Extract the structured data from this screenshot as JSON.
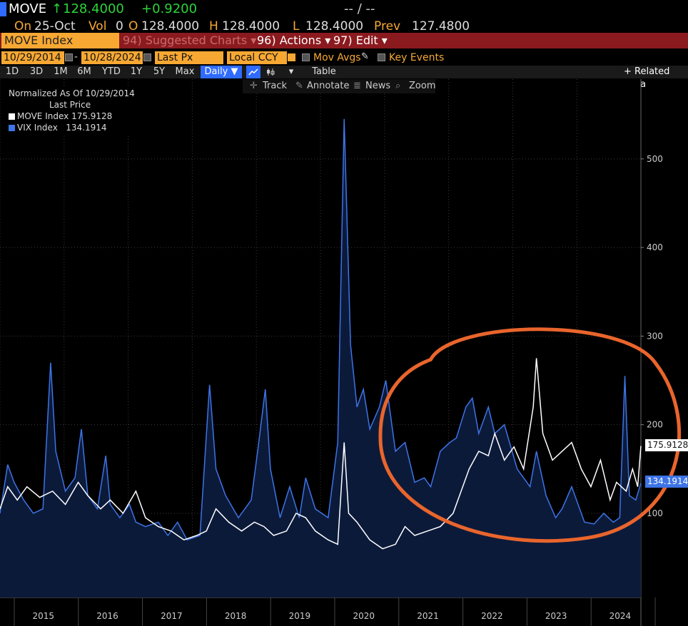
{
  "header": {
    "ticker": "MOVE",
    "arrow": "↑",
    "last": "128.4000",
    "change": "+0.9200",
    "bidask": "-- / --",
    "on_label": "On",
    "on_date": "25-Oct",
    "vol_label": "Vol",
    "vol_value": "0",
    "open_label": "O",
    "open_value": "128.4000",
    "high_label": "H",
    "high_value": "128.4000",
    "low_label": "L",
    "low_value": "128.4000",
    "prev_label": "Prev",
    "prev_value": "127.4800"
  },
  "menubar": {
    "title": "MOVE Index",
    "suggested_num": "94)",
    "suggested_label": "Suggested Charts",
    "actions_num": "96)",
    "actions_label": "Actions",
    "edit_num": "97)",
    "edit_label": "Edit",
    "dropdown_glyph": "▾"
  },
  "controls": {
    "start_date": "10/29/2014",
    "end_date": "10/28/2024",
    "dash": "-",
    "field": "Last Px",
    "currency": "Local CCY",
    "mov_avgs": "Mov Avgs",
    "key_events": "Key Events"
  },
  "periods": [
    "1D",
    "3D",
    "1M",
    "6M",
    "YTD",
    "1Y",
    "5Y",
    "Max"
  ],
  "frequency": "Daily ▼",
  "table_label": "Table",
  "related_label": "+ Related Data",
  "tools": {
    "track": "Track",
    "annotate": "Annotate",
    "news": "News",
    "zoom": "Zoom"
  },
  "legend": {
    "normalized": "Normalized As Of 10/29/2014",
    "last_price": "Last Price"
  },
  "colors": {
    "move": "#ffffff",
    "vix": "#3d74e6",
    "vix_fill": "#0c1a3a",
    "orange": "#f7a833",
    "annotation": "#e9652c",
    "menubar": "#8b1a1f"
  },
  "chart_data": {
    "type": "line",
    "x_ticks": [
      "2015",
      "2016",
      "2017",
      "2018",
      "2019",
      "2020",
      "2021",
      "2022",
      "2023",
      "2024"
    ],
    "y_ticks": [
      100,
      200,
      300,
      400,
      500
    ],
    "ylim": [
      5,
      590
    ],
    "xlim": [
      2014.83,
      2024.83
    ],
    "grid": true,
    "annotation": "orange ellipse around 2022-2024",
    "series": [
      {
        "name": "VIX Index",
        "color": "#3d74e6",
        "last": "134.1914",
        "points": [
          [
            2014.83,
            100
          ],
          [
            2014.95,
            155
          ],
          [
            2015.05,
            135
          ],
          [
            2015.2,
            115
          ],
          [
            2015.35,
            100
          ],
          [
            2015.5,
            105
          ],
          [
            2015.62,
            270
          ],
          [
            2015.7,
            170
          ],
          [
            2015.85,
            125
          ],
          [
            2016.0,
            140
          ],
          [
            2016.1,
            195
          ],
          [
            2016.2,
            120
          ],
          [
            2016.35,
            105
          ],
          [
            2016.48,
            165
          ],
          [
            2016.55,
            110
          ],
          [
            2016.7,
            95
          ],
          [
            2016.85,
            110
          ],
          [
            2016.95,
            90
          ],
          [
            2017.1,
            85
          ],
          [
            2017.3,
            90
          ],
          [
            2017.45,
            75
          ],
          [
            2017.6,
            90
          ],
          [
            2017.75,
            70
          ],
          [
            2017.95,
            75
          ],
          [
            2018.1,
            245
          ],
          [
            2018.2,
            150
          ],
          [
            2018.35,
            120
          ],
          [
            2018.55,
            95
          ],
          [
            2018.75,
            115
          ],
          [
            2018.85,
            170
          ],
          [
            2018.97,
            240
          ],
          [
            2019.05,
            150
          ],
          [
            2019.2,
            95
          ],
          [
            2019.35,
            130
          ],
          [
            2019.5,
            95
          ],
          [
            2019.6,
            140
          ],
          [
            2019.75,
            105
          ],
          [
            2019.95,
            95
          ],
          [
            2020.1,
            180
          ],
          [
            2020.2,
            545
          ],
          [
            2020.3,
            290
          ],
          [
            2020.4,
            220
          ],
          [
            2020.5,
            240
          ],
          [
            2020.6,
            195
          ],
          [
            2020.75,
            220
          ],
          [
            2020.85,
            250
          ],
          [
            2021.0,
            170
          ],
          [
            2021.15,
            180
          ],
          [
            2021.3,
            135
          ],
          [
            2021.45,
            140
          ],
          [
            2021.55,
            130
          ],
          [
            2021.7,
            170
          ],
          [
            2021.85,
            180
          ],
          [
            2021.95,
            185
          ],
          [
            2022.1,
            220
          ],
          [
            2022.2,
            230
          ],
          [
            2022.3,
            190
          ],
          [
            2022.45,
            220
          ],
          [
            2022.55,
            190
          ],
          [
            2022.7,
            200
          ],
          [
            2022.8,
            175
          ],
          [
            2022.9,
            150
          ],
          [
            2023.0,
            140
          ],
          [
            2023.1,
            130
          ],
          [
            2023.2,
            170
          ],
          [
            2023.35,
            120
          ],
          [
            2023.5,
            95
          ],
          [
            2023.6,
            105
          ],
          [
            2023.75,
            130
          ],
          [
            2023.85,
            110
          ],
          [
            2023.95,
            90
          ],
          [
            2024.1,
            88
          ],
          [
            2024.25,
            100
          ],
          [
            2024.4,
            90
          ],
          [
            2024.5,
            95
          ],
          [
            2024.58,
            255
          ],
          [
            2024.65,
            120
          ],
          [
            2024.75,
            115
          ],
          [
            2024.83,
            134
          ]
        ]
      },
      {
        "name": "MOVE Index",
        "color": "#ffffff",
        "last": "175.9128",
        "points": [
          [
            2014.83,
            105
          ],
          [
            2014.95,
            130
          ],
          [
            2015.1,
            115
          ],
          [
            2015.25,
            130
          ],
          [
            2015.45,
            118
          ],
          [
            2015.65,
            125
          ],
          [
            2015.85,
            110
          ],
          [
            2016.05,
            135
          ],
          [
            2016.2,
            120
          ],
          [
            2016.4,
            105
          ],
          [
            2016.55,
            115
          ],
          [
            2016.75,
            100
          ],
          [
            2016.95,
            125
          ],
          [
            2017.1,
            95
          ],
          [
            2017.3,
            85
          ],
          [
            2017.5,
            80
          ],
          [
            2017.7,
            70
          ],
          [
            2017.9,
            75
          ],
          [
            2018.05,
            80
          ],
          [
            2018.2,
            105
          ],
          [
            2018.4,
            90
          ],
          [
            2018.6,
            80
          ],
          [
            2018.8,
            90
          ],
          [
            2018.95,
            85
          ],
          [
            2019.1,
            75
          ],
          [
            2019.3,
            80
          ],
          [
            2019.45,
            100
          ],
          [
            2019.6,
            95
          ],
          [
            2019.75,
            80
          ],
          [
            2019.95,
            70
          ],
          [
            2020.1,
            65
          ],
          [
            2020.2,
            180
          ],
          [
            2020.27,
            100
          ],
          [
            2020.4,
            90
          ],
          [
            2020.6,
            70
          ],
          [
            2020.8,
            60
          ],
          [
            2021.0,
            65
          ],
          [
            2021.15,
            85
          ],
          [
            2021.3,
            75
          ],
          [
            2021.5,
            80
          ],
          [
            2021.7,
            85
          ],
          [
            2021.9,
            100
          ],
          [
            2022.0,
            120
          ],
          [
            2022.15,
            150
          ],
          [
            2022.3,
            170
          ],
          [
            2022.45,
            165
          ],
          [
            2022.55,
            190
          ],
          [
            2022.7,
            160
          ],
          [
            2022.85,
            175
          ],
          [
            2023.0,
            150
          ],
          [
            2023.15,
            220
          ],
          [
            2023.2,
            275
          ],
          [
            2023.3,
            190
          ],
          [
            2023.45,
            160
          ],
          [
            2023.6,
            170
          ],
          [
            2023.75,
            180
          ],
          [
            2023.9,
            150
          ],
          [
            2024.05,
            130
          ],
          [
            2024.2,
            160
          ],
          [
            2024.35,
            115
          ],
          [
            2024.45,
            135
          ],
          [
            2024.6,
            125
          ],
          [
            2024.7,
            150
          ],
          [
            2024.78,
            130
          ],
          [
            2024.83,
            176
          ]
        ]
      }
    ]
  }
}
